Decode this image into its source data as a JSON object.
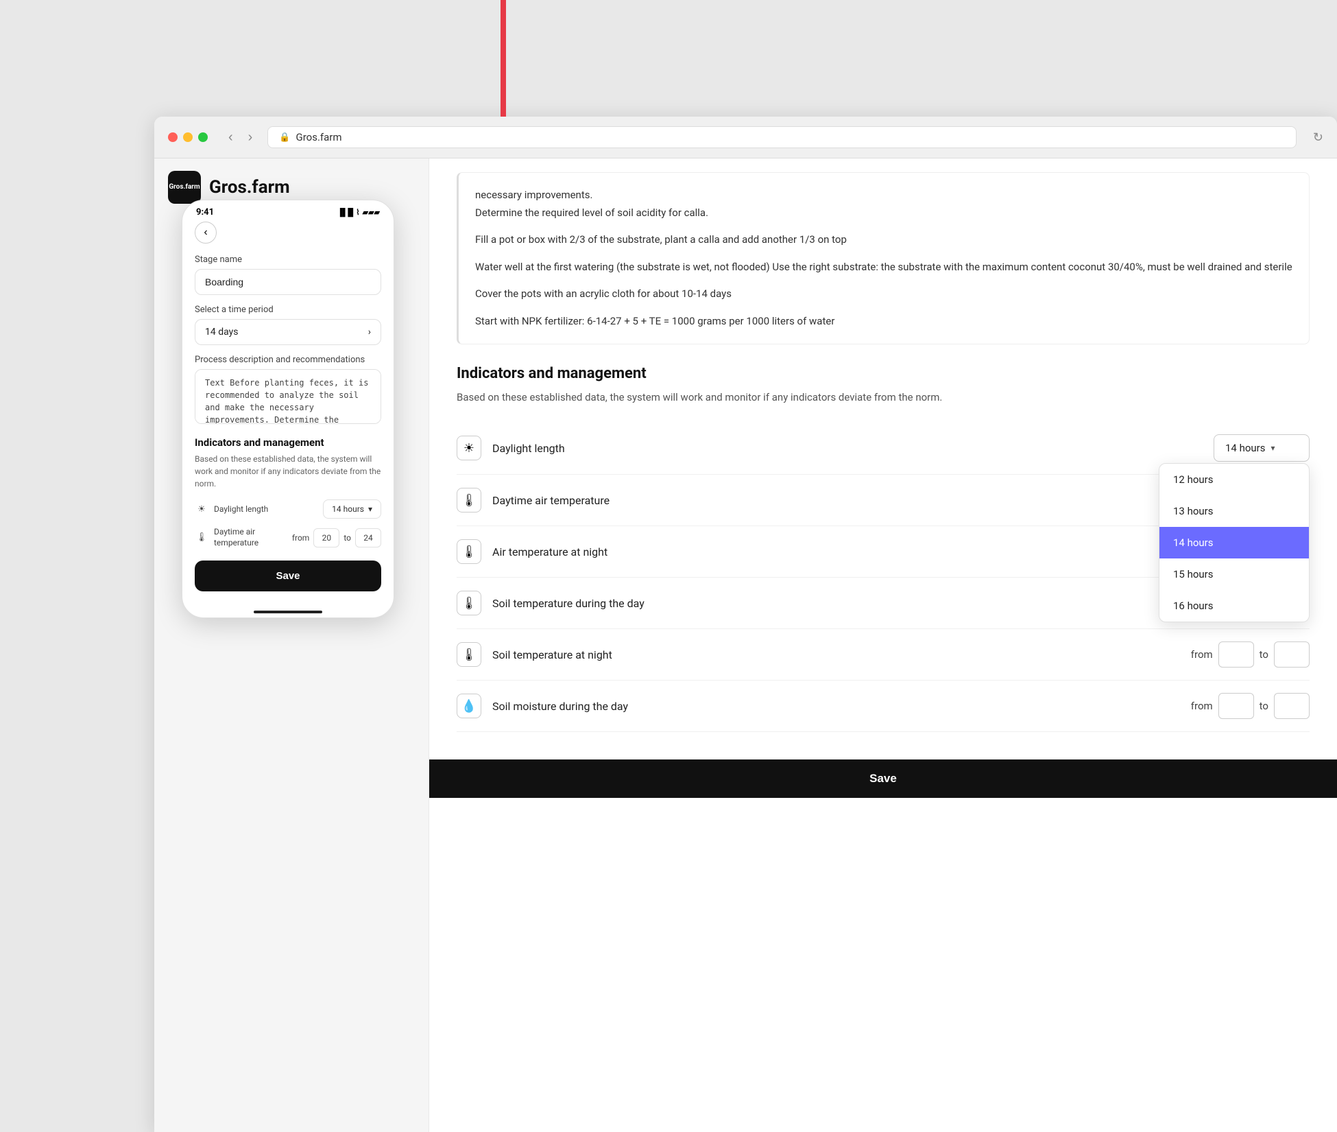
{
  "browser": {
    "address": "Gros.farm",
    "back_label": "‹",
    "forward_label": "›",
    "refresh_label": "↻"
  },
  "logo": {
    "icon_line1": "Gros.",
    "icon_line2": "farm",
    "text": "Gros.farm"
  },
  "phone": {
    "status_time": "9:41",
    "back_label": "‹",
    "stage_name_label": "Stage name",
    "stage_name_value": "Boarding",
    "time_period_label": "Select a time period",
    "time_period_value": "14 days",
    "process_desc_label": "Process description and recommendations",
    "process_desc_value": "Text Before planting feces, it is recommended to analyze the soil and make the necessary improvements. Determine the required level of soil acidity for calla.",
    "indicators_title": "Indicators and management",
    "indicators_desc": "Based on these established data, the system will work and monitor if any indicators deviate from the norm.",
    "daylight_label": "Daylight length",
    "daylight_value": "14 hours",
    "daytime_temp_label": "Daytime air temperature",
    "from_label": "from",
    "to_label": "to",
    "daytime_from": "20",
    "daytime_to": "24",
    "save_label": "Save"
  },
  "web": {
    "scrollable_text": [
      "necessary improvements.",
      "Determine the required level of soil acidity for calla.",
      "Fill a pot or box with 2/3 of the substrate, plant a calla and add another 1/3 on top",
      "Water well at the first watering (the substrate is wet, not flooded) Use the right substrate: the substrate with the maximum content coconut 30/40%, must be well drained and sterile",
      "Cover the pots with an acrylic cloth for about 10-14 days",
      "Start with NPK fertilizer: 6-14-27 + 5 + TE = 1000 grams per 1000 liters of water"
    ],
    "section_title": "Indicators and management",
    "section_desc": "Based on these established data, the system will work and monitor if any indicators deviate from the norm.",
    "indicators": [
      {
        "icon": "☀",
        "name": "Daylight length",
        "control_type": "dropdown",
        "value": "14 hours",
        "dropdown_open": true
      },
      {
        "icon": "🌡",
        "name": "Daytime air temperature",
        "control_type": "range",
        "from": "",
        "to": ""
      },
      {
        "icon": "🌡",
        "name": "Air temperature at night",
        "control_type": "range",
        "from": "",
        "to": ""
      },
      {
        "icon": "🌡",
        "name": "Soil temperature during the day",
        "control_type": "range",
        "from": "",
        "to": ""
      },
      {
        "icon": "🌡",
        "name": "Soil temperature at night",
        "control_type": "range",
        "from": "",
        "to": ""
      },
      {
        "icon": "💧",
        "name": "Soil moisture during the day",
        "control_type": "range",
        "from": "",
        "to": ""
      }
    ],
    "dropdown_options": [
      {
        "label": "12 hours",
        "active": false
      },
      {
        "label": "13 hours",
        "active": false
      },
      {
        "label": "14 hours",
        "active": true
      },
      {
        "label": "15 hours",
        "active": false
      },
      {
        "label": "16 hours",
        "active": false
      }
    ],
    "save_label": "Save",
    "from_label": "from",
    "to_label": "to"
  }
}
